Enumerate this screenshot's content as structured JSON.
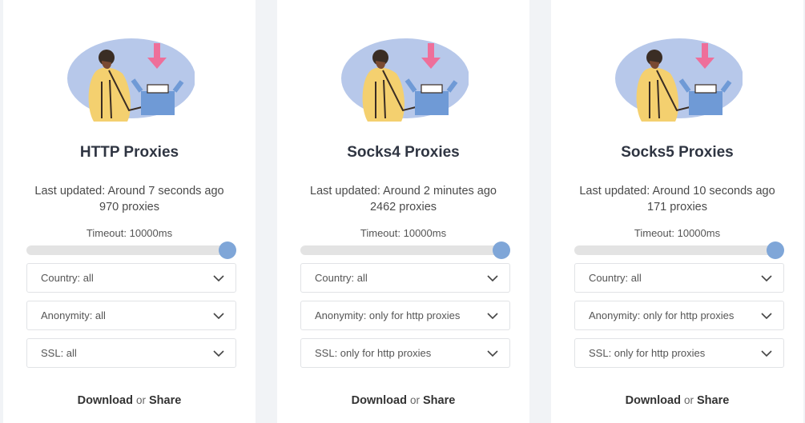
{
  "cards": [
    {
      "title": "HTTP Proxies",
      "updated": "Last updated: Around 7 seconds ago",
      "count": "970 proxies",
      "timeout": "Timeout: 10000ms",
      "timeout_level": 1.0,
      "country": "Country: all",
      "anonymity": "Anonymity: all",
      "ssl": "SSL: all",
      "download": "Download",
      "or": "or",
      "share": "Share"
    },
    {
      "title": "Socks4 Proxies",
      "updated": "Last updated: Around 2 minutes ago",
      "count": "2462 proxies",
      "timeout": "Timeout: 10000ms",
      "timeout_level": 1.0,
      "country": "Country: all",
      "anonymity": "Anonymity: only for http proxies",
      "ssl": "SSL: only for http proxies",
      "download": "Download",
      "or": "or",
      "share": "Share"
    },
    {
      "title": "Socks5 Proxies",
      "updated": "Last updated: Around 10 seconds ago",
      "count": "171 proxies",
      "timeout": "Timeout: 10000ms",
      "timeout_level": 1.0,
      "country": "Country: all",
      "anonymity": "Anonymity: only for http proxies",
      "ssl": "SSL: only for http proxies",
      "download": "Download",
      "or": "or",
      "share": "Share"
    }
  ],
  "icons": {
    "illustration": "person-opening-box-illustration",
    "chevron": "chevron-down-icon"
  },
  "colors": {
    "page_bg": "#f1f3f6",
    "accent": "#7fa6d8",
    "blob": "#b7c8ea",
    "arrow": "#ee6f9a",
    "shirt": "#f4d06f"
  }
}
